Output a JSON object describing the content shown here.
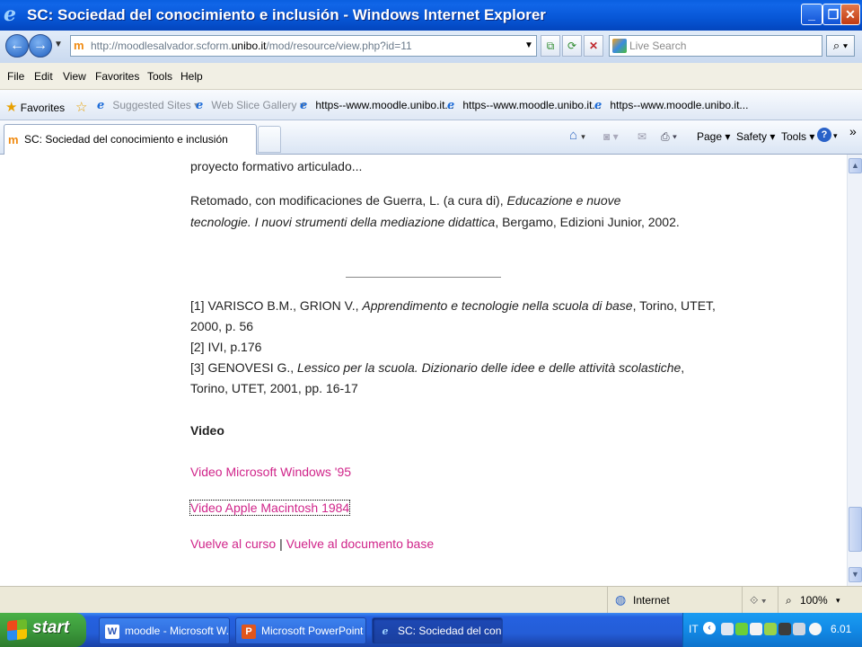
{
  "window": {
    "title": "SC: Sociedad del conocimiento e inclusión - Windows Internet Explorer",
    "controls": [
      "minimize",
      "maximize",
      "close"
    ]
  },
  "addressbar": {
    "url_prefix": "http://moodlesalvador.scform.",
    "url_host": "unibo.it",
    "url_suffix": "/mod/resource/view.php?id=11",
    "search_placeholder": "Live Search"
  },
  "menu": [
    "File",
    "Edit",
    "View",
    "Favorites",
    "Tools",
    "Help"
  ],
  "favorites": {
    "label": "Favorites",
    "items": [
      "Suggested Sites ▾",
      "Web Slice Gallery ▾",
      "https--www.moodle.unibo.it...",
      "https--www.moodle.unibo.it...",
      "https--www.moodle.unibo.it..."
    ]
  },
  "tabs": {
    "active_label": "SC: Sociedad del conocimiento e inclusión"
  },
  "commands": {
    "page": "Page ▾",
    "safety": "Safety ▾",
    "tools": "Tools ▾",
    "more": "»"
  },
  "content": {
    "line1": "proyecto formativo articulado...",
    "retomado_a": "Retomado, con modificaciones de Guerra, L. (a cura di), ",
    "retomado_b": "Educazione e nuove",
    "retomado_c": "tecnologie. I nuovi strumenti della mediazione didattica",
    "retomado_d": ", Bergamo, Edizioni Junior, 2002.",
    "ref1_a": "[1] VARISCO B.M., GRION V., ",
    "ref1_b": "Apprendimento e tecnologie nella scuola di base",
    "ref1_c": ", Torino, UTET,",
    "ref1_d": "2000, p. 56",
    "ref2": "[2] IVI, p.176",
    "ref3_a": "[3] GENOVESI G., ",
    "ref3_b": "Lessico per la scuola. Dizionario delle idee e delle attività scolastiche",
    "ref3_c": ",",
    "ref3_d": "Torino, UTET, 2001, pp. 16-17",
    "video_heading": "Video",
    "video_link1": "Video Microsoft Windows '95",
    "video_link2": "Video Apple Macintosh 1984",
    "back_link1": "Vuelve al curso",
    "separator": " | ",
    "back_link2": "Vuelve al documento base"
  },
  "status": {
    "zone": "Internet",
    "zoom": "100%"
  },
  "taskbar": {
    "start": "start",
    "tasks": [
      "moodle - Microsoft W...",
      "Microsoft PowerPoint ...",
      "SC: Sociedad del con..."
    ],
    "lang": "IT",
    "clock": "6.01"
  },
  "colors": {
    "link": "#d0258a",
    "titlebar": "#0756d6",
    "taskbar": "#245dd7",
    "start": "#3c9a3c"
  }
}
